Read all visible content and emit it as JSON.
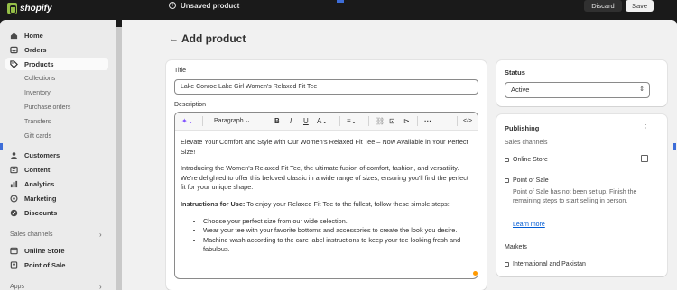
{
  "topbar": {
    "brand": "shopify",
    "status_text": "Unsaved product",
    "discard_label": "Discard",
    "save_label": "Save"
  },
  "sidebar": {
    "items": [
      {
        "label": "Home",
        "icon": "home-icon"
      },
      {
        "label": "Orders",
        "icon": "inbox-icon"
      },
      {
        "label": "Products",
        "icon": "tag-icon",
        "active": true
      },
      {
        "label": "Collections",
        "sub": true
      },
      {
        "label": "Inventory",
        "sub": true
      },
      {
        "label": "Purchase orders",
        "sub": true
      },
      {
        "label": "Transfers",
        "sub": true
      },
      {
        "label": "Gift cards",
        "sub": true
      },
      {
        "label": "Customers",
        "icon": "person-icon"
      },
      {
        "label": "Content",
        "icon": "content-icon"
      },
      {
        "label": "Analytics",
        "icon": "chart-icon"
      },
      {
        "label": "Marketing",
        "icon": "target-icon"
      },
      {
        "label": "Discounts",
        "icon": "discount-icon"
      }
    ],
    "sales_channels_label": "Sales channels",
    "channels": [
      {
        "label": "Online Store",
        "icon": "store-icon"
      },
      {
        "label": "Point of Sale",
        "icon": "pos-icon"
      }
    ],
    "apps_label": "Apps"
  },
  "page": {
    "back_icon": "arrow-left-icon",
    "title": "Add product"
  },
  "product": {
    "title_label": "Title",
    "title_value": "Lake Conroe Lake Girl Women's Relaxed Fit Tee",
    "description_label": "Description",
    "toolbar": {
      "ai_icon": "sparkle-icon",
      "paragraph_label": "Paragraph",
      "bold": "B",
      "italic": "I",
      "underline": "U",
      "text_color": "A"
    },
    "description": {
      "p1": "Elevate Your Comfort and Style with Our Women's Relaxed Fit Tee – Now Available in Your Perfect Size!",
      "p2": "Introducing the Women's Relaxed Fit Tee, the ultimate fusion of comfort, fashion, and versatility. We're delighted to offer this beloved classic in a wide range of sizes, ensuring you'll find the perfect fit for your unique shape.",
      "p3_bold": "Instructions for Use:",
      "p3_rest": " To enjoy your Relaxed Fit Tee to the fullest, follow these simple steps:",
      "bullets": [
        "Choose your perfect size from our wide selection.",
        "Wear your tee with your favorite bottoms and accessories to create the look you desire.",
        "Machine wash according to the care label instructions to keep your tee looking fresh and fabulous."
      ]
    }
  },
  "status": {
    "label": "Status",
    "value": "Active"
  },
  "publishing": {
    "title": "Publishing",
    "sales_channels_label": "Sales channels",
    "online_store": "Online Store",
    "point_of_sale": "Point of Sale",
    "pos_note": "Point of Sale has not been set up. Finish the remaining steps to start selling in person.",
    "learn_more": "Learn more",
    "markets_label": "Markets",
    "markets_value": "International and Pakistan"
  },
  "colors": {
    "topbar": "#1a1a1a",
    "sidebar": "#ebebeb",
    "main_bg": "#f1f1f1",
    "link": "#005bd3",
    "brand_green": "#95bf47"
  }
}
